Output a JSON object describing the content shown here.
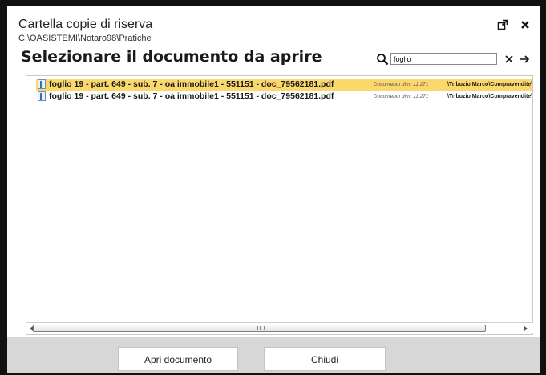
{
  "window": {
    "title": "Cartella copie di riserva",
    "path": "C:\\OASISTEMI\\Notaro98\\Pratiche",
    "heading": "Selezionare il documento da aprire"
  },
  "search": {
    "value": "foglio"
  },
  "icons": {
    "popout": "popout-icon",
    "close": "close-icon",
    "search": "search-icon",
    "clear": "clear-icon",
    "go": "arrow-right-icon",
    "document": "document-icon"
  },
  "files": [
    {
      "name": "foglio 19 - part. 649 - sub. 7 - oa immobile1 - 551151 - doc_79562181.pdf",
      "meta": "Documento dim. 11.271",
      "folder": "\\Tribuzio Marco\\Compravendite\\",
      "selected": true
    },
    {
      "name": "foglio 19 - part. 649 - sub. 7 - oa immobile1 - 551151 - doc_79562181.pdf",
      "meta": "Documento dim. 11.271",
      "folder": "\\Tribuzio Marco\\Compravendite\\",
      "selected": false
    }
  ],
  "buttons": {
    "open": "Apri documento",
    "close": "Chiudi"
  },
  "colors": {
    "selection": "#fbd86b",
    "footer": "#d7d7d7",
    "frame": "#111111"
  }
}
